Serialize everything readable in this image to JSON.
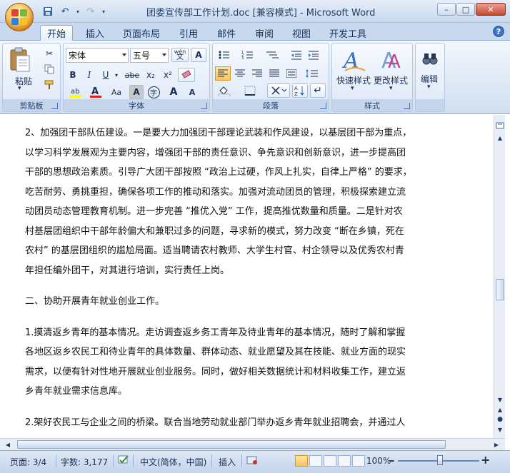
{
  "window": {
    "title": "团委宣传部工作计划.doc [兼容模式] - Microsoft Word",
    "controls": {
      "minimize": "–",
      "maximize": "□",
      "close": "✕"
    }
  },
  "tabs": [
    {
      "label": "开始",
      "active": true
    },
    {
      "label": "插入"
    },
    {
      "label": "页面布局"
    },
    {
      "label": "引用"
    },
    {
      "label": "邮件"
    },
    {
      "label": "审阅"
    },
    {
      "label": "视图"
    },
    {
      "label": "开发工具"
    }
  ],
  "ribbon": {
    "clipboard": {
      "label": "剪贴板",
      "paste_label": "粘贴"
    },
    "font": {
      "label": "字体",
      "font_name": "宋体",
      "font_size": "五号",
      "buttons": {
        "bold": "B",
        "italic": "I",
        "underline": "U",
        "strike": "abe",
        "subscript": "x₂",
        "superscript": "x²",
        "change_case": "Aa",
        "grow": "A",
        "shrink": "A",
        "char_shade": "A",
        "enclose": "字",
        "wen": "wén",
        "border": "A"
      }
    },
    "paragraph": {
      "label": "段落"
    },
    "styles": {
      "label": "样式",
      "quick_styles": "快速样式",
      "change_styles": "更改样式"
    },
    "editing": {
      "label": "编辑"
    }
  },
  "document": {
    "paragraphs": [
      {
        "lines": [
          "2、加强团干部队伍建设。一是要大力加强团干部理论武装和作风建设，以基层团干部为重点，",
          "以学习科学发展观为主要内容，增强团干部的责任意识、争先意识和创新意识，进一步提高团",
          "干部的思想政治素质。引导广大团干部按照 “政治上过硬，作风上扎实，自律上严格” 的要求，",
          "吃苦耐劳、勇挑重担，确保各项工作的推动和落实。加强对流动团员的管理，积极探索建立流",
          "动团员动态管理教育机制。进一步完善 “推优入党” 工作，提高推优数量和质量。二是针对农",
          "村基层团组织中干部年龄偏大和兼职过多的问题，寻求新的模式，努力改变 “断在乡镇，死在",
          "农村” 的基层团组织的尴尬局面。适当聘请农村教师、大学生村官、村企领导以及优秀农村青",
          "年担任编外团干，对其进行培训，实行责任上岗。"
        ]
      },
      {
        "lines": [
          "二、协助开展青年就业创业工作。"
        ]
      },
      {
        "lines": [
          "1.摸清返乡青年的基本情况。走访调查返乡务工青年及待业青年的基本情况，随时了解和掌握",
          "各地区返乡农民工和待业青年的具体数量、群体动态、就业愿望及其在技能、就业方面的现实",
          "需求，以便有针对性地开展就业创业服务。同时，做好相关数据统计和材料收集工作，建立返",
          "乡青年就业需求信息库。"
        ]
      },
      {
        "lines": [
          "2.架好农民工与企业之间的桥梁。联合当地劳动就业部门举办返乡青年就业招聘会，并通过人"
        ]
      }
    ]
  },
  "status": {
    "page": "页面: 3/4",
    "words": "字数: 3,177",
    "language": "中文(简体，中国)",
    "mode": "插入",
    "zoom": "100%",
    "zoom_minus": "–",
    "zoom_plus": "+"
  }
}
